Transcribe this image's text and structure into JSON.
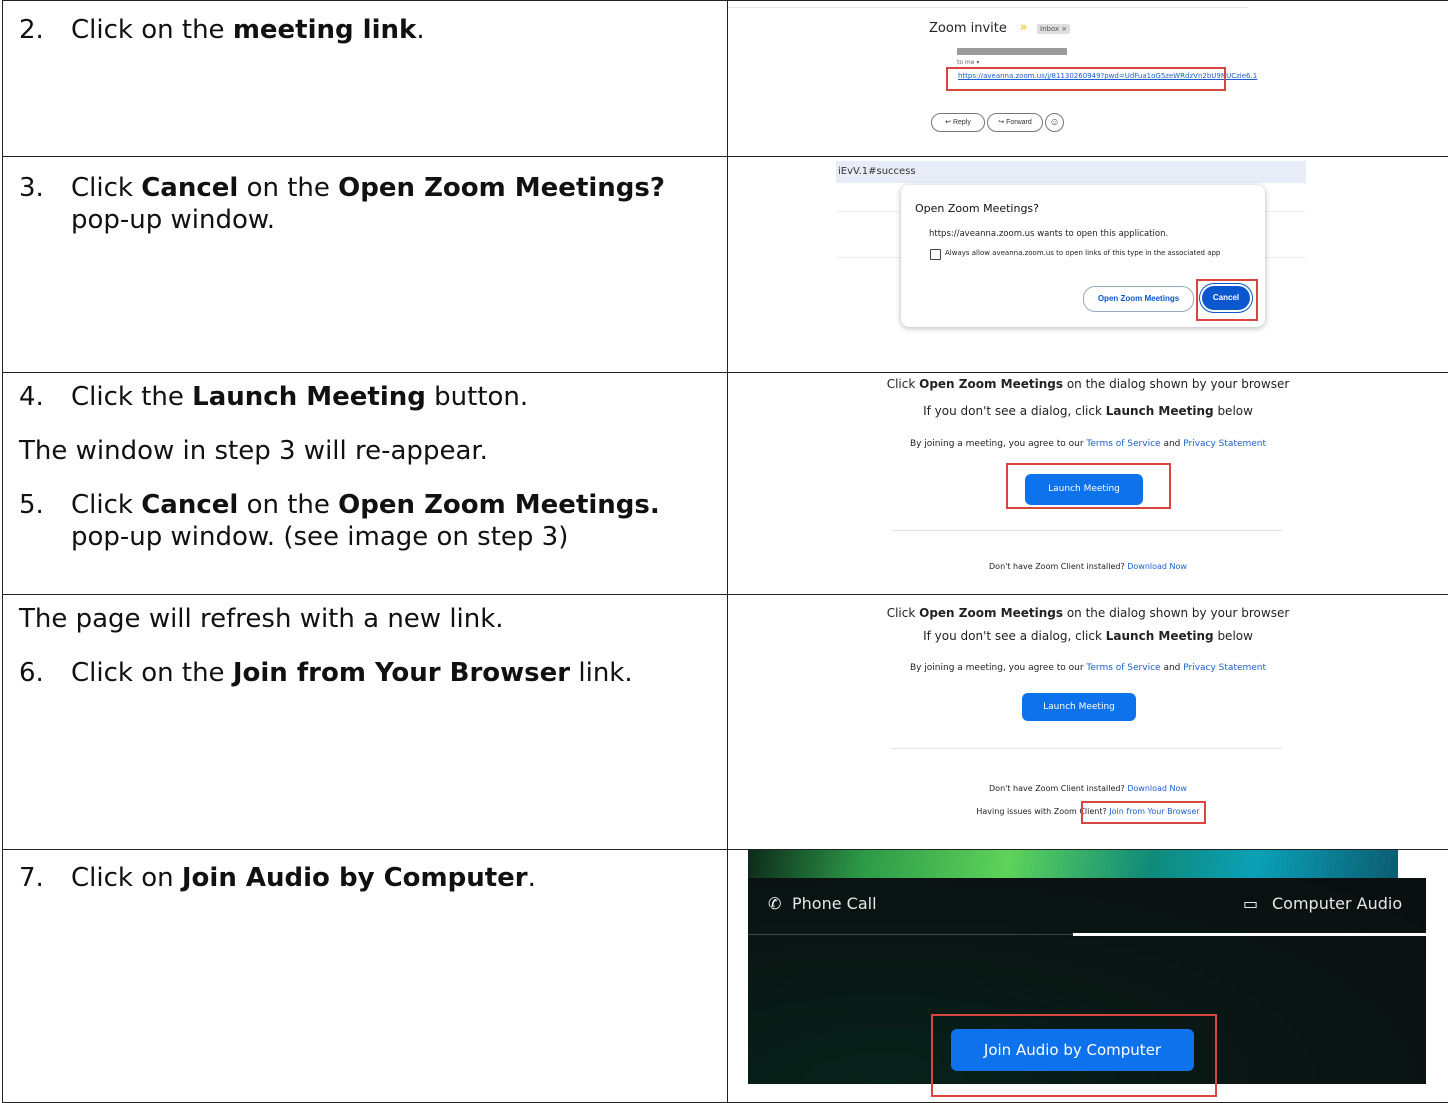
{
  "rows": [
    {
      "left": {
        "num": "2.",
        "pre": "Click on the ",
        "bold": "meeting link",
        "post": "."
      },
      "shot": {
        "subject": "Zoom invite",
        "inbox_badge": "Inbox ×",
        "to_me": "to me ▾",
        "link": "https://aveanna.zoom.us/j/81130260949?pwd=UdFua1oG5zeWRdzVn2bU9NUCzie6.1",
        "reply": "Reply",
        "forward": "Forward"
      }
    },
    {
      "left": {
        "num": "3.",
        "pre": "Click ",
        "bold1": "Cancel",
        "mid": " on the ",
        "bold2": "Open Zoom Meetings?",
        "post": " pop-up window."
      },
      "shot": {
        "url_fragment": "iEvV.1#success",
        "dialog_title": "Open Zoom Meetings?",
        "dialog_text": "https://aveanna.zoom.us wants to open this application.",
        "checkbox_label": "Always allow aveanna.zoom.us to open links of this type in the associated app",
        "open_button": "Open Zoom Meetings",
        "cancel_button": "Cancel"
      }
    },
    {
      "left": {
        "step4": {
          "num": "4.",
          "pre": "Click the ",
          "bold": "Launch Meeting",
          "post": " button."
        },
        "note": "The window in step 3 will re-appear.",
        "step5": {
          "num": "5.",
          "pre": "Click ",
          "bold1": "Cancel",
          "mid": " on the ",
          "bold2": "Open Zoom Meetings.",
          "post": " pop-up window.  (see image on step 3)"
        }
      },
      "shot": {
        "line1_pre": "Click ",
        "line1_bold": "Open Zoom Meetings",
        "line1_post": " on the dialog shown by your browser",
        "line2_pre": "If you don't see a dialog, click ",
        "line2_bold": "Launch Meeting",
        "line2_post": " below",
        "agree_pre": "By joining a meeting, you agree to our ",
        "terms": "Terms of Service",
        "and": " and ",
        "privacy": "Privacy Statement",
        "launch_button": "Launch Meeting",
        "no_client": "Don't have Zoom Client installed? ",
        "download": "Download Now"
      }
    },
    {
      "left": {
        "note": "The page will refresh with a new link.",
        "step6": {
          "num": "6.",
          "pre": "Click on the ",
          "bold": "Join from Your Browser",
          "post": " link."
        }
      },
      "shot": {
        "line1_pre": "Click ",
        "line1_bold": "Open Zoom Meetings",
        "line1_post": " on the dialog shown by your browser",
        "line2_pre": "If you don't see a dialog, click ",
        "line2_bold": "Launch Meeting",
        "line2_post": " below",
        "agree_pre": "By joining a meeting, you agree to our ",
        "terms": "Terms of Service",
        "and": " and ",
        "privacy": "Privacy Statement",
        "launch_button": "Launch Meeting",
        "no_client": "Don't have Zoom Client installed? ",
        "download": "Download Now",
        "issues": "Having issues with Zoom Client? ",
        "join_browser": "Join from Your Browser"
      }
    },
    {
      "left": {
        "num": "7.",
        "pre": "Click on ",
        "bold": "Join Audio by Computer",
        "post": "."
      },
      "shot": {
        "phone_call": "Phone Call",
        "computer_audio": "Computer Audio",
        "join_audio_button": "Join Audio by Computer"
      }
    }
  ],
  "colors": {
    "zoom_blue": "#0e72ed",
    "highlight_red": "#d9463f",
    "link_blue": "#1a5fd0",
    "dialog_blue": "#0b57d0"
  }
}
